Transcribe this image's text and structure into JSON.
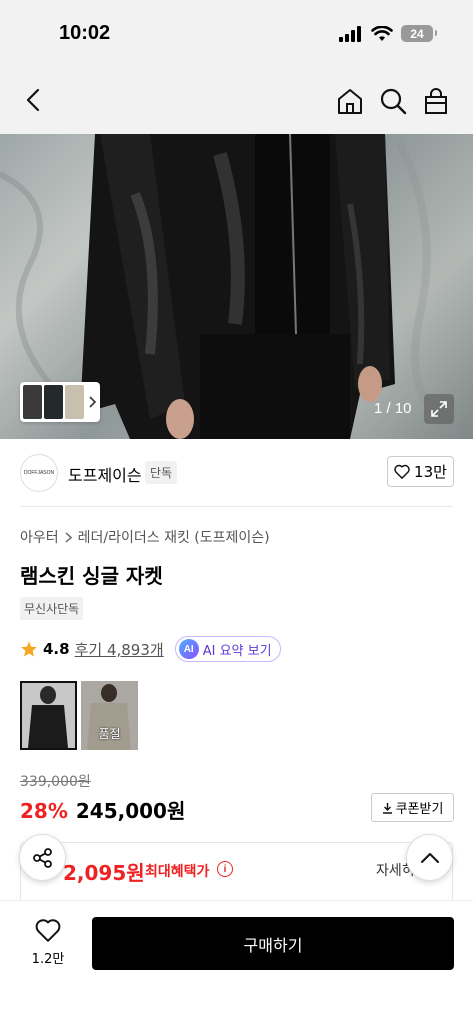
{
  "status_bar": {
    "time": "10:02",
    "battery": "24"
  },
  "nav": {
    "icons": [
      "chevron-left-icon",
      "home-icon",
      "search-icon",
      "shopping-bag-icon"
    ]
  },
  "gallery": {
    "counter": "1 / 10"
  },
  "brand": {
    "logo_text": "DOFFJASON",
    "name": "도프제이슨",
    "badge": "단독",
    "like_count": "13만"
  },
  "product": {
    "breadcrumb": [
      "아우터",
      "레더/라이더스 재킷 (도프제이슨)"
    ],
    "title": "램스킨 싱글 자켓",
    "tag": "무신사단독",
    "rating": "4.8",
    "reviews": "후기 4,893개",
    "ai_summary": "AI 요약 보기",
    "ai_badge": "AI",
    "color_options": [
      {
        "color": "#1b1b1b",
        "selected": true,
        "label": ""
      },
      {
        "color": "#d9d0bf",
        "selected": false,
        "label": "품절"
      }
    ],
    "original_price": "339,000원",
    "discount": "28%",
    "price": "245,000원",
    "coupon": "쿠폰받기"
  },
  "benefit": {
    "amount": "2,095원",
    "label": "최대혜택가",
    "detail": "자세히"
  },
  "bottom": {
    "like_count": "1.2만",
    "buy_label": "구매하기"
  },
  "colors": {
    "accent_red": "#ee2222",
    "ai_purple": "#5d3bd6",
    "buy_black": "#000000"
  }
}
